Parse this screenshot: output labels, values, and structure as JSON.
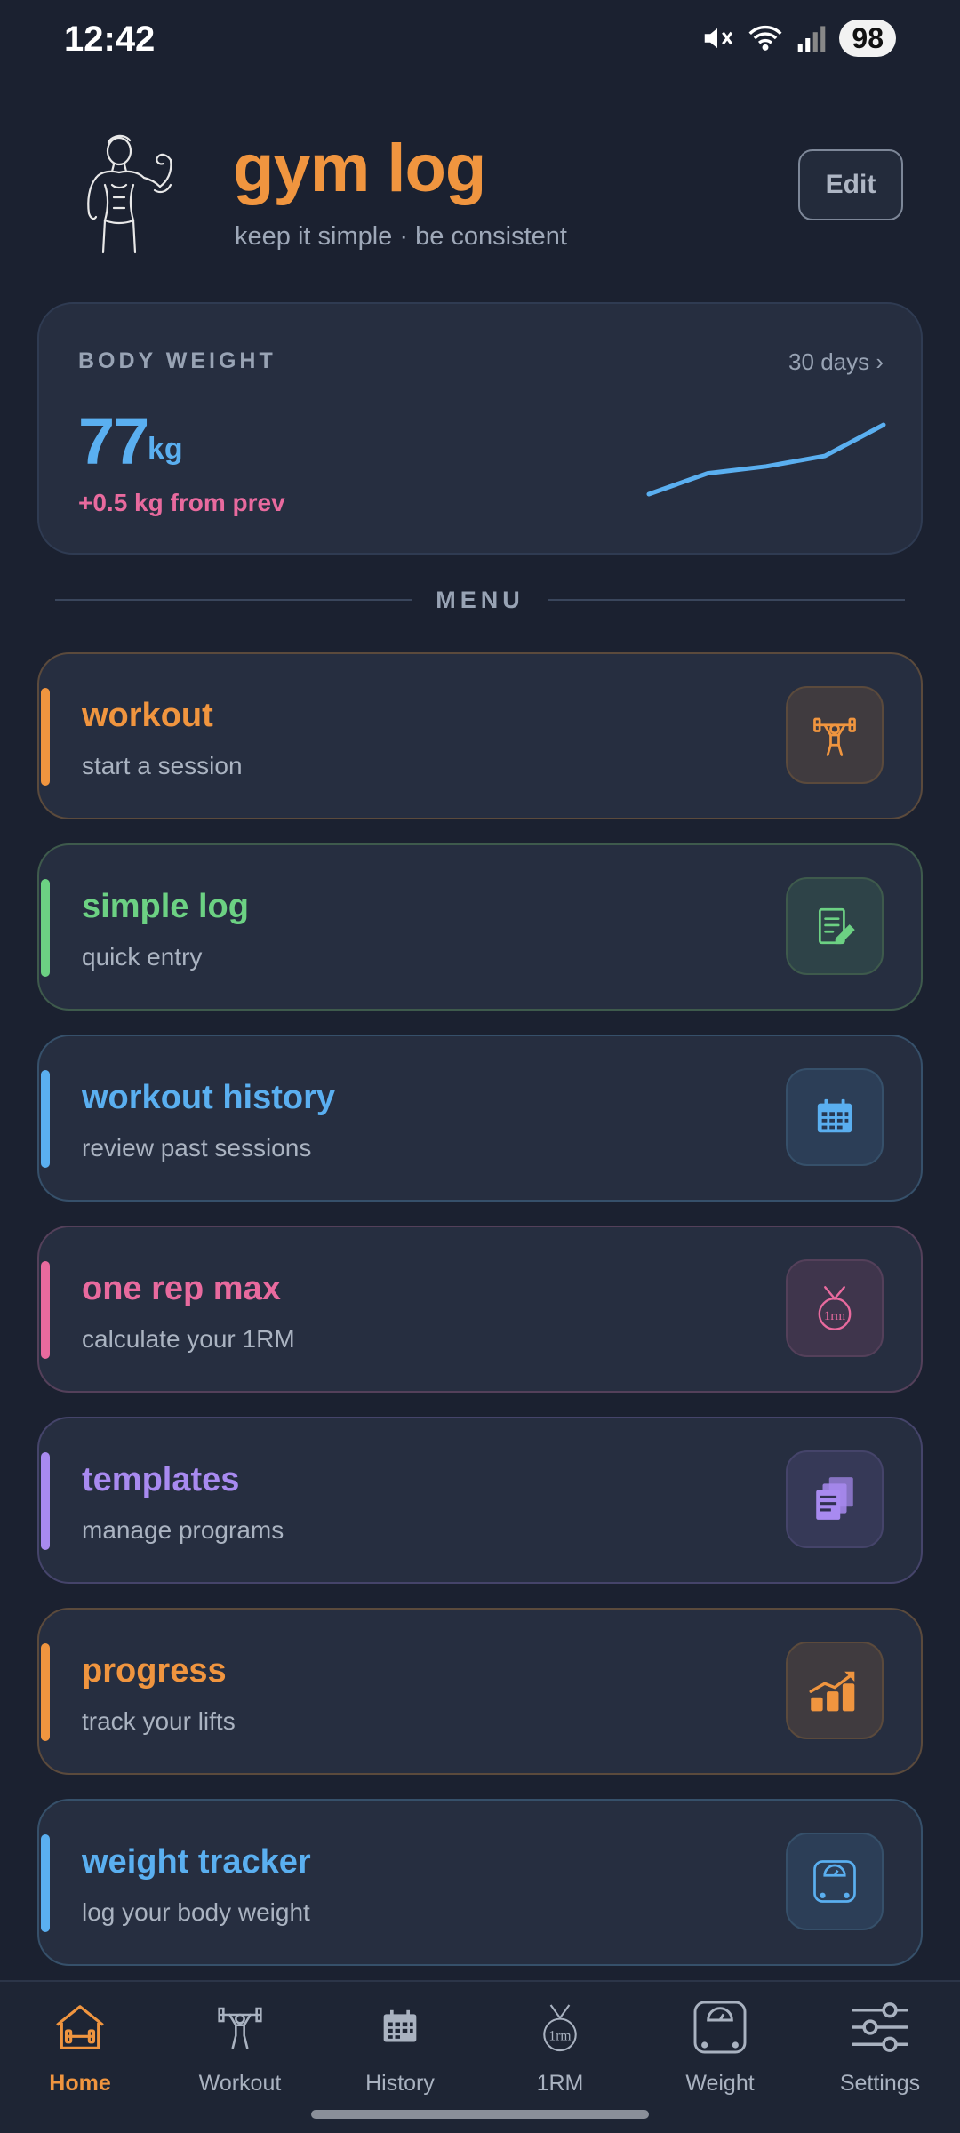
{
  "status": {
    "time": "12:42",
    "battery": "98"
  },
  "header": {
    "title": "gym log",
    "subtitle": "keep it simple · be consistent",
    "edit_label": "Edit"
  },
  "body_weight": {
    "label": "BODY WEIGHT",
    "range": "30 days ›",
    "value": "77",
    "unit": "kg",
    "change": "+0.5 kg from prev",
    "trend": [
      0,
      0.3,
      0.4,
      0.55,
      1
    ]
  },
  "menu": {
    "label": "MENU",
    "items": [
      {
        "title": "workout",
        "desc": "start a session",
        "icon": "dumbbell-person-icon",
        "color": "#f0953f",
        "border": "#5b4a3c"
      },
      {
        "title": "simple log",
        "desc": "quick entry",
        "icon": "notepad-icon",
        "color": "#6cd183",
        "border": "#3e5a4c"
      },
      {
        "title": "workout history",
        "desc": "review past sessions",
        "icon": "calendar-icon",
        "color": "#5aaff0",
        "border": "#36506a"
      },
      {
        "title": "one rep max",
        "desc": "calculate your 1RM",
        "icon": "medal-icon",
        "color": "#e86a9e",
        "border": "#54405a"
      },
      {
        "title": "templates",
        "desc": "manage programs",
        "icon": "stacked-documents-icon",
        "color": "#a88af0",
        "border": "#45446a"
      },
      {
        "title": "progress",
        "desc": "track your lifts",
        "icon": "bar-chart-up-icon",
        "color": "#f0953f",
        "border": "#5b4a3c"
      },
      {
        "title": "weight tracker",
        "desc": "log your body weight",
        "icon": "scale-icon",
        "color": "#5aaff0",
        "border": "#36506a"
      }
    ]
  },
  "nav": {
    "items": [
      {
        "label": "Home",
        "icon": "home-dumbbell-icon"
      },
      {
        "label": "Workout",
        "icon": "weightlifter-icon"
      },
      {
        "label": "History",
        "icon": "calendar-icon"
      },
      {
        "label": "1RM",
        "icon": "medal-icon"
      },
      {
        "label": "Weight",
        "icon": "scale-icon"
      },
      {
        "label": "Settings",
        "icon": "sliders-icon"
      }
    ],
    "active": "Home"
  }
}
